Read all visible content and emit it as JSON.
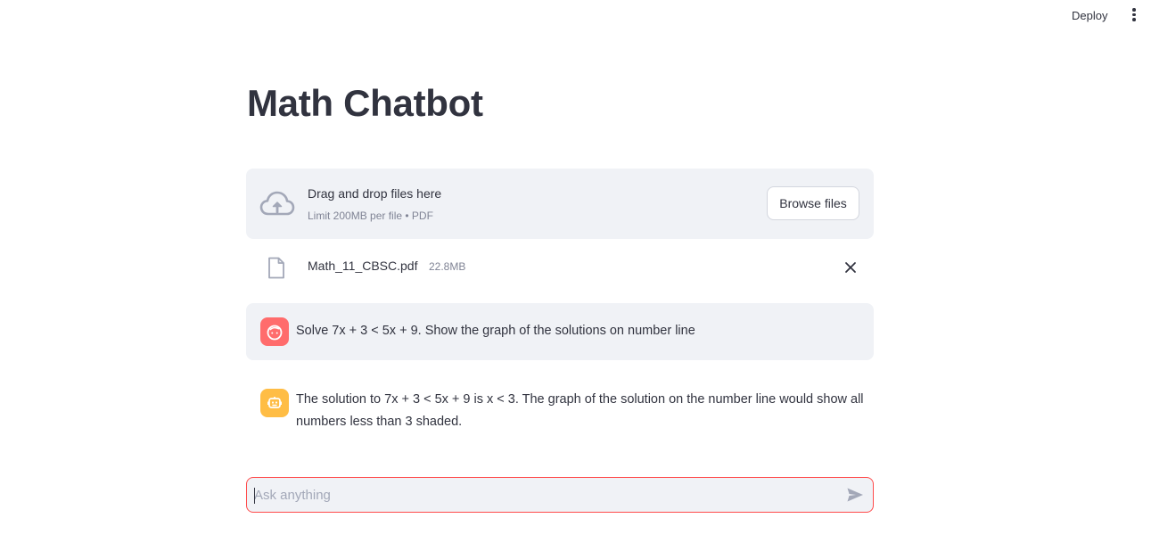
{
  "header": {
    "deploy_label": "Deploy",
    "menu_icon": "kebab-menu-icon"
  },
  "page": {
    "title": "Math Chatbot"
  },
  "uploader": {
    "icon": "cloud-upload-icon",
    "instruction": "Drag and drop files here",
    "limits": "Limit 200MB per file • PDF",
    "browse_label": "Browse files",
    "files": [
      {
        "icon": "file-icon",
        "name": "Math_11_CBSC.pdf",
        "size": "22.8MB",
        "remove_icon": "close-icon"
      }
    ]
  },
  "messages": [
    {
      "role": "user",
      "avatar_icon": "user-face-icon",
      "avatar_color": "#ff6c6c",
      "text": "Solve 7x + 3 < 5x + 9. Show the graph of the solutions on number line"
    },
    {
      "role": "assistant",
      "avatar_icon": "robot-icon",
      "avatar_color": "#ffbd45",
      "text": "The solution to 7x + 3 < 5x + 9 is x < 3. The graph of the solution on the number line would show all numbers less than 3 shaded."
    }
  ],
  "chat_input": {
    "placeholder": "Ask anything",
    "value": "",
    "send_icon": "send-icon"
  },
  "colors": {
    "accent": "#ff4b4b",
    "panel_bg": "#f0f2f6",
    "text": "#31333f",
    "muted": "#808495"
  }
}
